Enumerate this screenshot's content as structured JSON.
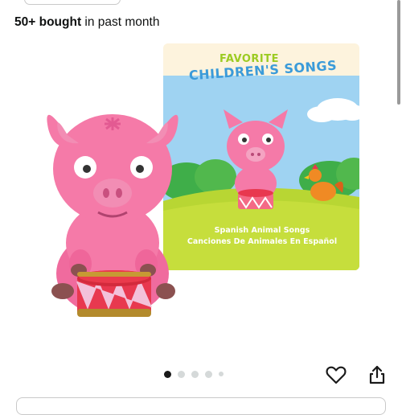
{
  "listing": {
    "bought_count": "50+ bought",
    "bought_suffix": " in past month"
  },
  "product_image": {
    "card_title_line1": "FAVORITE",
    "card_title_line2": "CHILDREN'S SONGS",
    "card_subtitle_line1": "Spanish Animal Songs",
    "card_subtitle_line2": "Canciones De Animales En Español",
    "pig_color": "#f57aa8",
    "drum_color": "#e8384f",
    "sky_color": "#9fd3f2",
    "grass_color": "#b8d633"
  },
  "carousel": {
    "total_dots": 5,
    "active_index": 0
  },
  "actions": {
    "wishlist_icon": "heart-icon",
    "share_icon": "share-icon"
  },
  "colors": {
    "text": "#0f1111",
    "dot_active": "#1a1a1a",
    "dot_inactive": "#d5d9d9"
  }
}
